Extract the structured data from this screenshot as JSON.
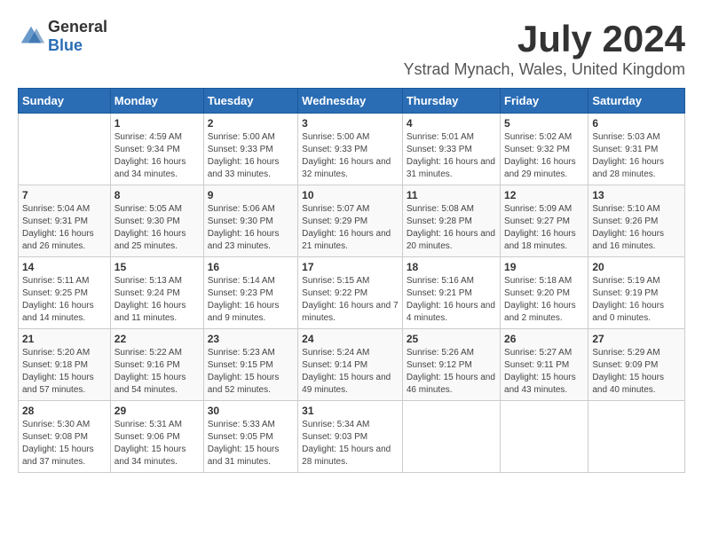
{
  "header": {
    "logo_general": "General",
    "logo_blue": "Blue",
    "month": "July 2024",
    "location": "Ystrad Mynach, Wales, United Kingdom"
  },
  "days_of_week": [
    "Sunday",
    "Monday",
    "Tuesday",
    "Wednesday",
    "Thursday",
    "Friday",
    "Saturday"
  ],
  "weeks": [
    [
      {
        "day": "",
        "sunrise": "",
        "sunset": "",
        "daylight": ""
      },
      {
        "day": "1",
        "sunrise": "Sunrise: 4:59 AM",
        "sunset": "Sunset: 9:34 PM",
        "daylight": "Daylight: 16 hours and 34 minutes."
      },
      {
        "day": "2",
        "sunrise": "Sunrise: 5:00 AM",
        "sunset": "Sunset: 9:33 PM",
        "daylight": "Daylight: 16 hours and 33 minutes."
      },
      {
        "day": "3",
        "sunrise": "Sunrise: 5:00 AM",
        "sunset": "Sunset: 9:33 PM",
        "daylight": "Daylight: 16 hours and 32 minutes."
      },
      {
        "day": "4",
        "sunrise": "Sunrise: 5:01 AM",
        "sunset": "Sunset: 9:33 PM",
        "daylight": "Daylight: 16 hours and 31 minutes."
      },
      {
        "day": "5",
        "sunrise": "Sunrise: 5:02 AM",
        "sunset": "Sunset: 9:32 PM",
        "daylight": "Daylight: 16 hours and 29 minutes."
      },
      {
        "day": "6",
        "sunrise": "Sunrise: 5:03 AM",
        "sunset": "Sunset: 9:31 PM",
        "daylight": "Daylight: 16 hours and 28 minutes."
      }
    ],
    [
      {
        "day": "7",
        "sunrise": "Sunrise: 5:04 AM",
        "sunset": "Sunset: 9:31 PM",
        "daylight": "Daylight: 16 hours and 26 minutes."
      },
      {
        "day": "8",
        "sunrise": "Sunrise: 5:05 AM",
        "sunset": "Sunset: 9:30 PM",
        "daylight": "Daylight: 16 hours and 25 minutes."
      },
      {
        "day": "9",
        "sunrise": "Sunrise: 5:06 AM",
        "sunset": "Sunset: 9:30 PM",
        "daylight": "Daylight: 16 hours and 23 minutes."
      },
      {
        "day": "10",
        "sunrise": "Sunrise: 5:07 AM",
        "sunset": "Sunset: 9:29 PM",
        "daylight": "Daylight: 16 hours and 21 minutes."
      },
      {
        "day": "11",
        "sunrise": "Sunrise: 5:08 AM",
        "sunset": "Sunset: 9:28 PM",
        "daylight": "Daylight: 16 hours and 20 minutes."
      },
      {
        "day": "12",
        "sunrise": "Sunrise: 5:09 AM",
        "sunset": "Sunset: 9:27 PM",
        "daylight": "Daylight: 16 hours and 18 minutes."
      },
      {
        "day": "13",
        "sunrise": "Sunrise: 5:10 AM",
        "sunset": "Sunset: 9:26 PM",
        "daylight": "Daylight: 16 hours and 16 minutes."
      }
    ],
    [
      {
        "day": "14",
        "sunrise": "Sunrise: 5:11 AM",
        "sunset": "Sunset: 9:25 PM",
        "daylight": "Daylight: 16 hours and 14 minutes."
      },
      {
        "day": "15",
        "sunrise": "Sunrise: 5:13 AM",
        "sunset": "Sunset: 9:24 PM",
        "daylight": "Daylight: 16 hours and 11 minutes."
      },
      {
        "day": "16",
        "sunrise": "Sunrise: 5:14 AM",
        "sunset": "Sunset: 9:23 PM",
        "daylight": "Daylight: 16 hours and 9 minutes."
      },
      {
        "day": "17",
        "sunrise": "Sunrise: 5:15 AM",
        "sunset": "Sunset: 9:22 PM",
        "daylight": "Daylight: 16 hours and 7 minutes."
      },
      {
        "day": "18",
        "sunrise": "Sunrise: 5:16 AM",
        "sunset": "Sunset: 9:21 PM",
        "daylight": "Daylight: 16 hours and 4 minutes."
      },
      {
        "day": "19",
        "sunrise": "Sunrise: 5:18 AM",
        "sunset": "Sunset: 9:20 PM",
        "daylight": "Daylight: 16 hours and 2 minutes."
      },
      {
        "day": "20",
        "sunrise": "Sunrise: 5:19 AM",
        "sunset": "Sunset: 9:19 PM",
        "daylight": "Daylight: 16 hours and 0 minutes."
      }
    ],
    [
      {
        "day": "21",
        "sunrise": "Sunrise: 5:20 AM",
        "sunset": "Sunset: 9:18 PM",
        "daylight": "Daylight: 15 hours and 57 minutes."
      },
      {
        "day": "22",
        "sunrise": "Sunrise: 5:22 AM",
        "sunset": "Sunset: 9:16 PM",
        "daylight": "Daylight: 15 hours and 54 minutes."
      },
      {
        "day": "23",
        "sunrise": "Sunrise: 5:23 AM",
        "sunset": "Sunset: 9:15 PM",
        "daylight": "Daylight: 15 hours and 52 minutes."
      },
      {
        "day": "24",
        "sunrise": "Sunrise: 5:24 AM",
        "sunset": "Sunset: 9:14 PM",
        "daylight": "Daylight: 15 hours and 49 minutes."
      },
      {
        "day": "25",
        "sunrise": "Sunrise: 5:26 AM",
        "sunset": "Sunset: 9:12 PM",
        "daylight": "Daylight: 15 hours and 46 minutes."
      },
      {
        "day": "26",
        "sunrise": "Sunrise: 5:27 AM",
        "sunset": "Sunset: 9:11 PM",
        "daylight": "Daylight: 15 hours and 43 minutes."
      },
      {
        "day": "27",
        "sunrise": "Sunrise: 5:29 AM",
        "sunset": "Sunset: 9:09 PM",
        "daylight": "Daylight: 15 hours and 40 minutes."
      }
    ],
    [
      {
        "day": "28",
        "sunrise": "Sunrise: 5:30 AM",
        "sunset": "Sunset: 9:08 PM",
        "daylight": "Daylight: 15 hours and 37 minutes."
      },
      {
        "day": "29",
        "sunrise": "Sunrise: 5:31 AM",
        "sunset": "Sunset: 9:06 PM",
        "daylight": "Daylight: 15 hours and 34 minutes."
      },
      {
        "day": "30",
        "sunrise": "Sunrise: 5:33 AM",
        "sunset": "Sunset: 9:05 PM",
        "daylight": "Daylight: 15 hours and 31 minutes."
      },
      {
        "day": "31",
        "sunrise": "Sunrise: 5:34 AM",
        "sunset": "Sunset: 9:03 PM",
        "daylight": "Daylight: 15 hours and 28 minutes."
      },
      {
        "day": "",
        "sunrise": "",
        "sunset": "",
        "daylight": ""
      },
      {
        "day": "",
        "sunrise": "",
        "sunset": "",
        "daylight": ""
      },
      {
        "day": "",
        "sunrise": "",
        "sunset": "",
        "daylight": ""
      }
    ]
  ]
}
